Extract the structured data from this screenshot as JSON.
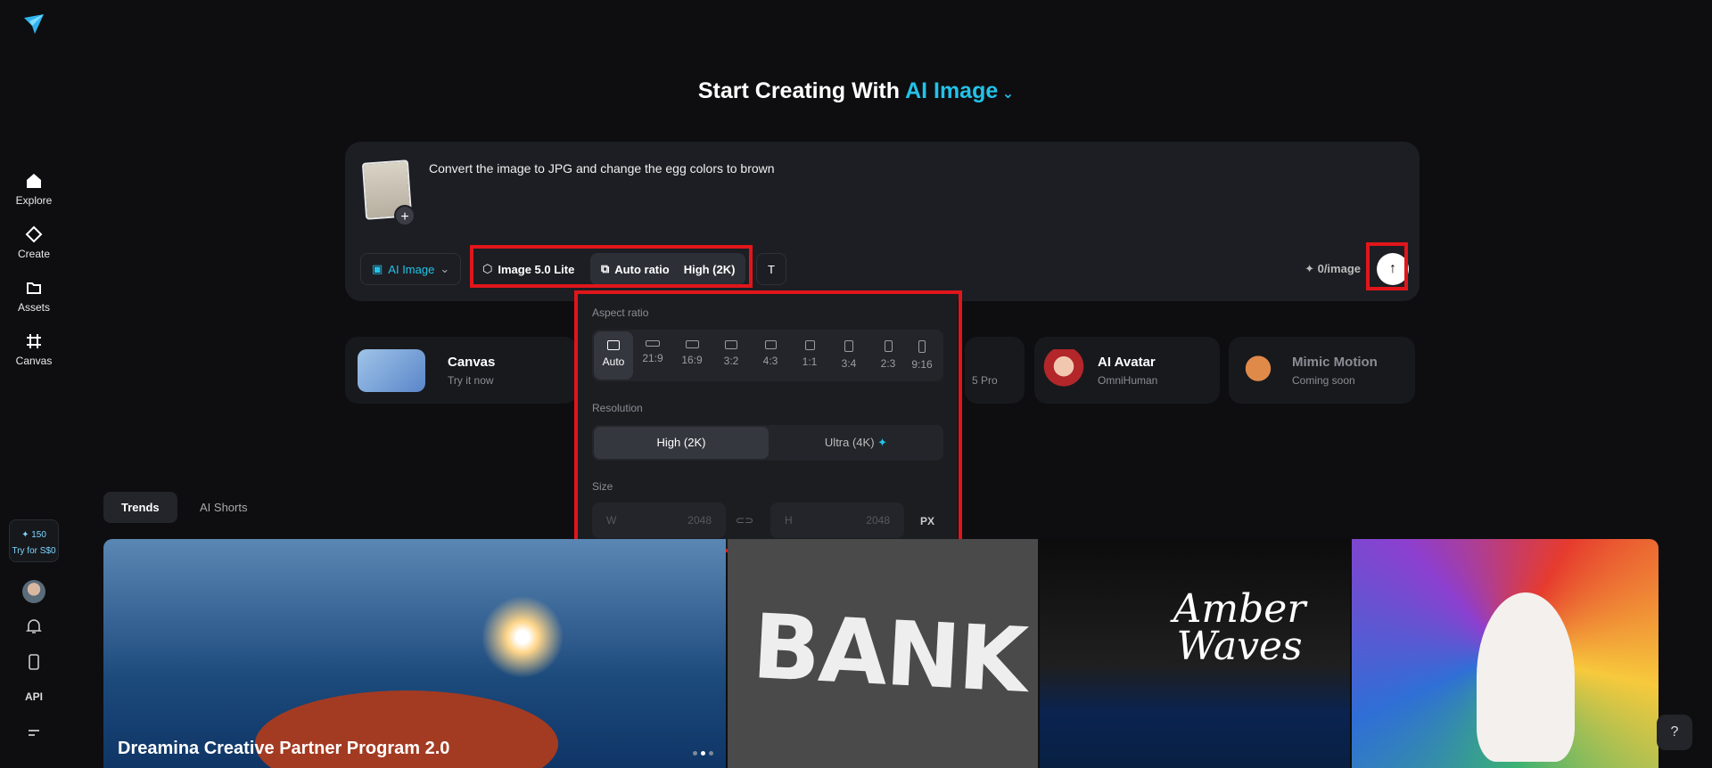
{
  "sidebar": {
    "logo_icon": "paper-plane-logo",
    "items": [
      {
        "label": "Explore",
        "icon": "home-icon"
      },
      {
        "label": "Create",
        "icon": "diamond-icon"
      },
      {
        "label": "Assets",
        "icon": "folder-icon"
      },
      {
        "label": "Canvas",
        "icon": "canvas-icon"
      }
    ],
    "credits": "✦ 150",
    "credits_cta": "Try for S$0",
    "api_label": "API"
  },
  "headline": {
    "prefix": "Start Creating With",
    "mode": "AI Image"
  },
  "prompt": {
    "text": "Convert the image to JPG and change the egg colors to brown",
    "mode_label": "AI Image",
    "model_label": "Image 5.0 Lite",
    "ratio_label": "Auto ratio",
    "quality_label": "High (2K)",
    "cost_label": "✦ 0/image"
  },
  "feature_cards": [
    {
      "title": "Canvas",
      "subtitle": "Try it now"
    },
    {
      "title": "",
      "subtitle": "5 Pro"
    },
    {
      "title": "AI Avatar",
      "subtitle": "OmniHuman"
    },
    {
      "title": "Mimic Motion",
      "subtitle": "Coming soon"
    }
  ],
  "popup": {
    "aspect_title": "Aspect ratio",
    "ratios": [
      "Auto",
      "21:9",
      "16:9",
      "3:2",
      "4:3",
      "1:1",
      "3:4",
      "2:3",
      "9:16"
    ],
    "selected_ratio": "Auto",
    "resolution_title": "Resolution",
    "resolutions": [
      "High (2K)",
      "Ultra (4K)"
    ],
    "selected_resolution": "High (2K)",
    "size_title": "Size",
    "width_label": "W",
    "width_value": "2048",
    "height_label": "H",
    "height_value": "2048",
    "unit": "PX"
  },
  "tabs": [
    "Trends",
    "AI Shorts"
  ],
  "gallery": {
    "banner_caption": "Dreamina Creative Partner Program 2.0",
    "tile2_text": "BANK",
    "tile3_text": "Amber Waves"
  },
  "colors": {
    "accent": "#23c2e8",
    "highlight": "#e0161b",
    "background": "#0e0e10",
    "card": "#1c1e23"
  }
}
